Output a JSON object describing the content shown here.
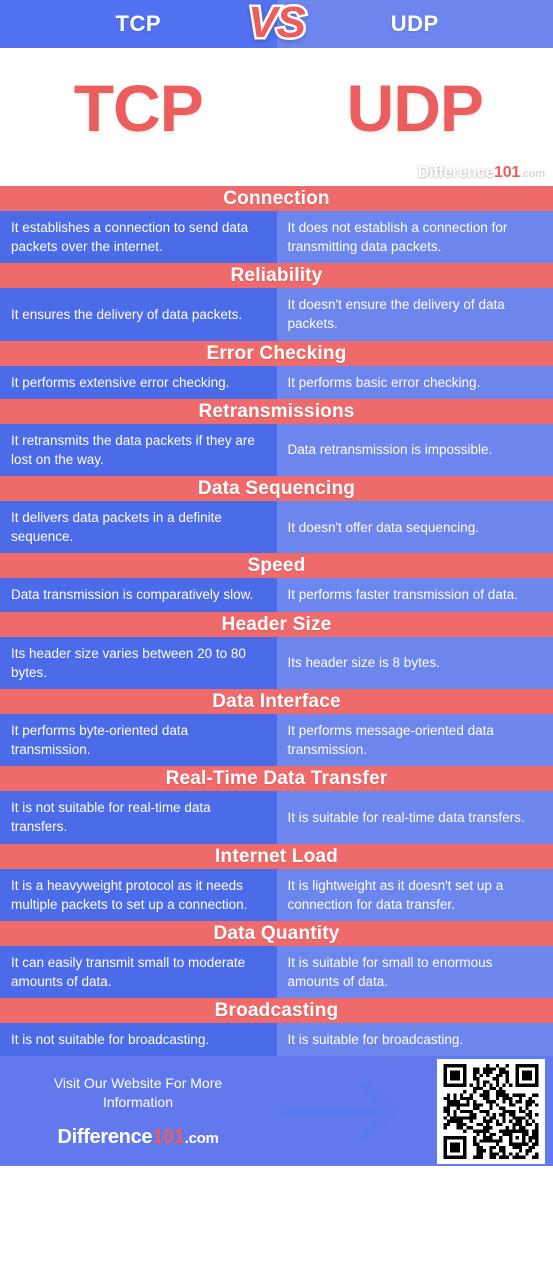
{
  "header": {
    "left_label": "TCP",
    "right_label": "UDP",
    "vs_label": "VS"
  },
  "hero": {
    "left_title": "TCP",
    "right_title": "UDP",
    "logo": {
      "word": "Difference",
      "number": "101",
      "tld": ".com"
    }
  },
  "table": {
    "column_headers": [
      "TCP",
      "UDP"
    ],
    "sections": [
      {
        "title": "Connection",
        "tcp": "It establishes a connection to send data packets over the internet.",
        "udp": "It does not establish a connection for transmitting data packets."
      },
      {
        "title": "Reliability",
        "tcp": "It ensures the delivery of data packets.",
        "udp": "It doesn't ensure the delivery of data packets."
      },
      {
        "title": "Error Checking",
        "tcp": "It performs extensive error checking.",
        "udp": "It performs basic error checking."
      },
      {
        "title": "Retransmissions",
        "tcp": "It retransmits the data packets if they are lost on the way.",
        "udp": "Data retransmission is impossible."
      },
      {
        "title": "Data Sequencing",
        "tcp": "It delivers data packets in a definite sequence.",
        "udp": "It doesn't offer data sequencing."
      },
      {
        "title": "Speed",
        "tcp": "Data transmission is comparatively slow.",
        "udp": "It performs faster transmission of data."
      },
      {
        "title": "Header Size",
        "tcp": "Its header size varies between 20 to 80 bytes.",
        "udp": "Its header size is 8 bytes."
      },
      {
        "title": "Data Interface",
        "tcp": "It performs byte-oriented data transmission.",
        "udp": "It performs message-oriented data transmission."
      },
      {
        "title": "Real-Time Data Transfer",
        "tcp": "It is not suitable for real-time data transfers.",
        "udp": "It is suitable for real-time data transfers."
      },
      {
        "title": "Internet Load",
        "tcp": "It is a heavyweight protocol as it needs multiple packets to set up a connection.",
        "udp": "It is lightweight as it doesn't set up a connection for data transfer."
      },
      {
        "title": "Data Quantity",
        "tcp": "It can easily transmit small to moderate amounts of data.",
        "udp": "It is suitable for small to enormous amounts of data."
      },
      {
        "title": "Broadcasting",
        "tcp": "It is not suitable for broadcasting.",
        "udp": "It is suitable for broadcasting."
      }
    ]
  },
  "footer": {
    "cta_line1": "Visit Our Website For More",
    "cta_line2": "Information",
    "logo": {
      "word": "Difference",
      "number": "101",
      "tld": ".com"
    },
    "arrow_icon": "arrow-right-icon",
    "qr_icon": "qr-code-icon"
  },
  "colors": {
    "red_band": "#EF6A6A",
    "red_accent": "#EC5E5E",
    "blue_left": "#4B6BE8",
    "blue_right": "#6C86EE",
    "blue_header_left": "#5271F0",
    "blue_footer": "#6279EE",
    "text_on_fill": "#FFFFFF"
  }
}
